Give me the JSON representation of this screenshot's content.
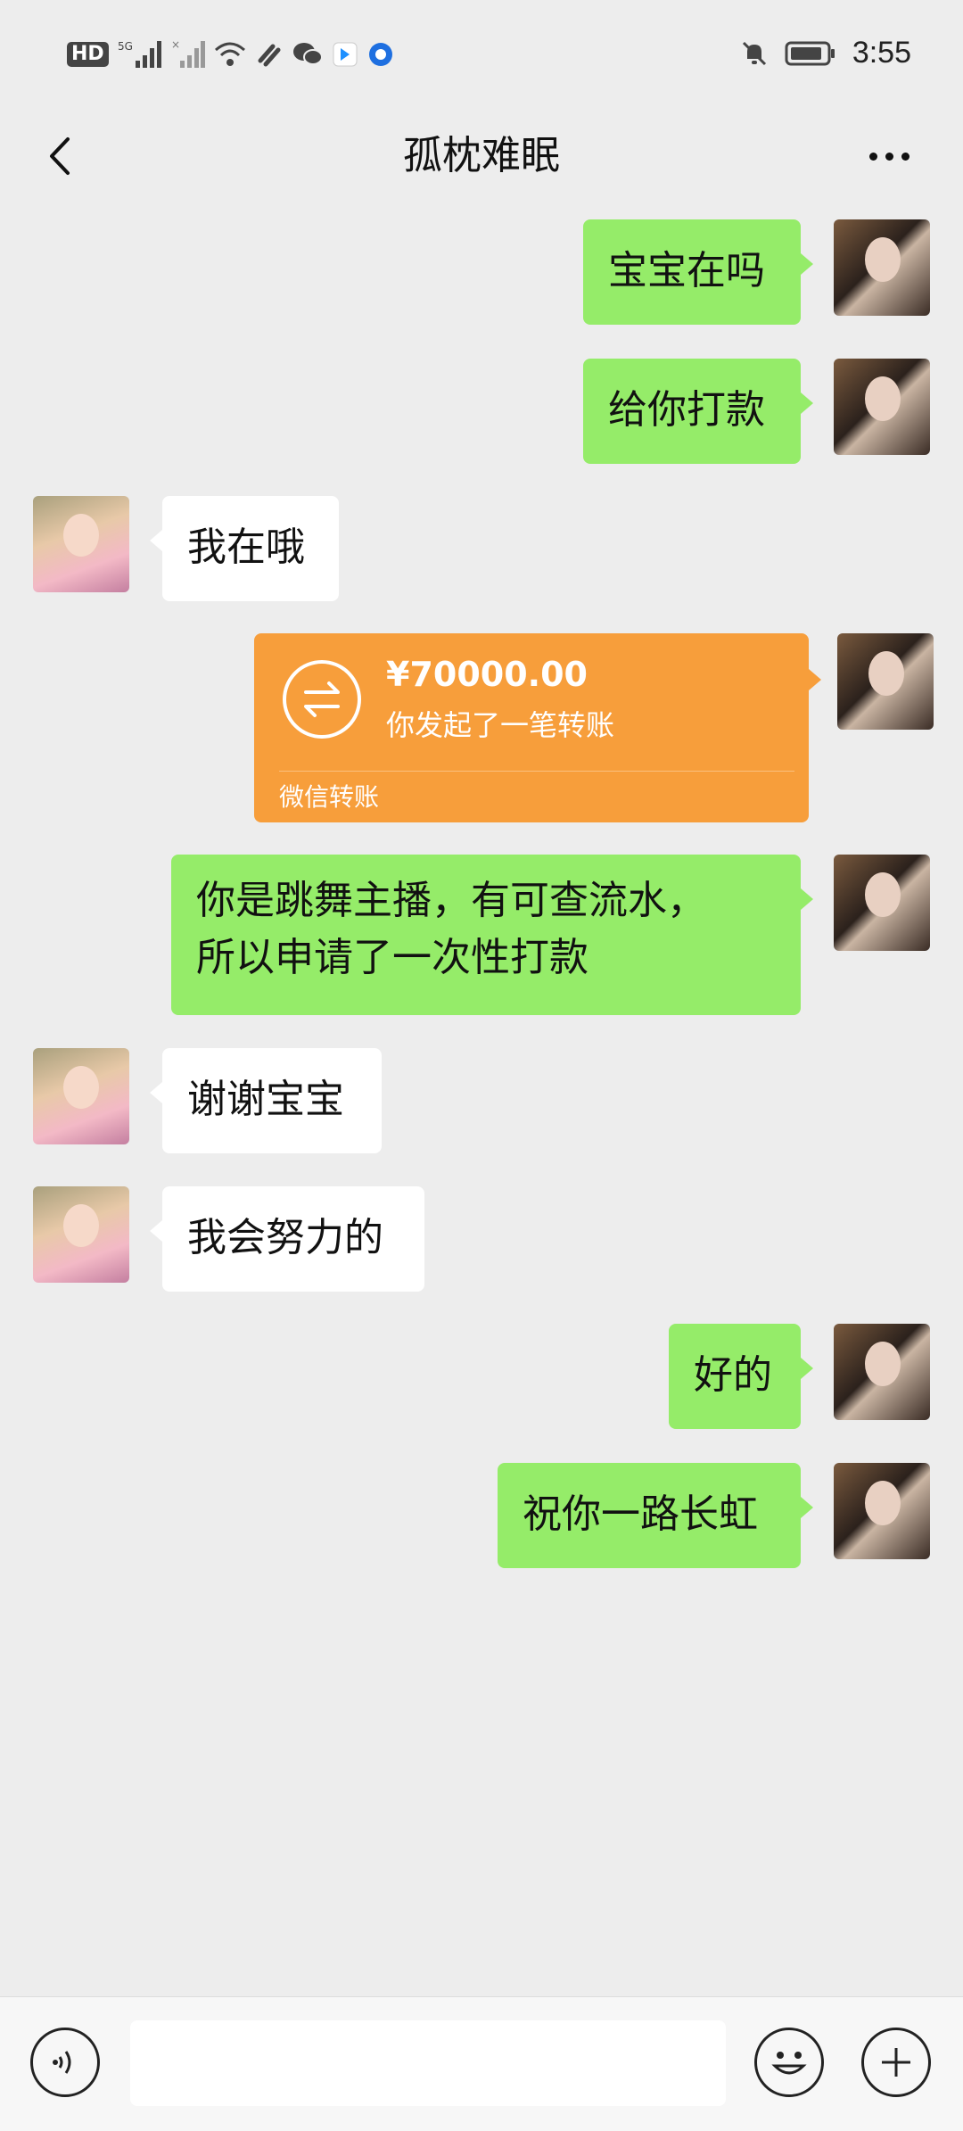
{
  "status_bar": {
    "time": "3:55",
    "hd_label": "HD",
    "network_label": "5G"
  },
  "header": {
    "title": "孤枕难眠",
    "back_icon": "back-arrow-icon",
    "more_icon": "more-dots-icon"
  },
  "messages": [
    {
      "from": "self",
      "text": "宝宝在吗"
    },
    {
      "from": "self",
      "text": "给你打款"
    },
    {
      "from": "other",
      "text": "我在哦"
    },
    {
      "from": "self",
      "type": "transfer"
    },
    {
      "from": "self",
      "text_line1": "你是跳舞主播，有可查流水，",
      "text_line2": "所以申请了一次性打款"
    },
    {
      "from": "other",
      "text": "谢谢宝宝"
    },
    {
      "from": "other",
      "text": "我会努力的"
    },
    {
      "from": "self",
      "text": "好的"
    },
    {
      "from": "self",
      "text": "祝你一路长虹"
    }
  ],
  "transfer": {
    "amount": "¥70000.00",
    "description": "你发起了一笔转账",
    "footer": "微信转账"
  },
  "input_bar": {
    "input_value": "",
    "voice_icon": "voice-icon",
    "emoji_icon": "emoji-icon",
    "plus_icon": "plus-icon"
  },
  "colors": {
    "background": "#ededed",
    "outgoing_bubble": "#95ec69",
    "incoming_bubble": "#ffffff",
    "transfer_card": "#f79e3b"
  }
}
